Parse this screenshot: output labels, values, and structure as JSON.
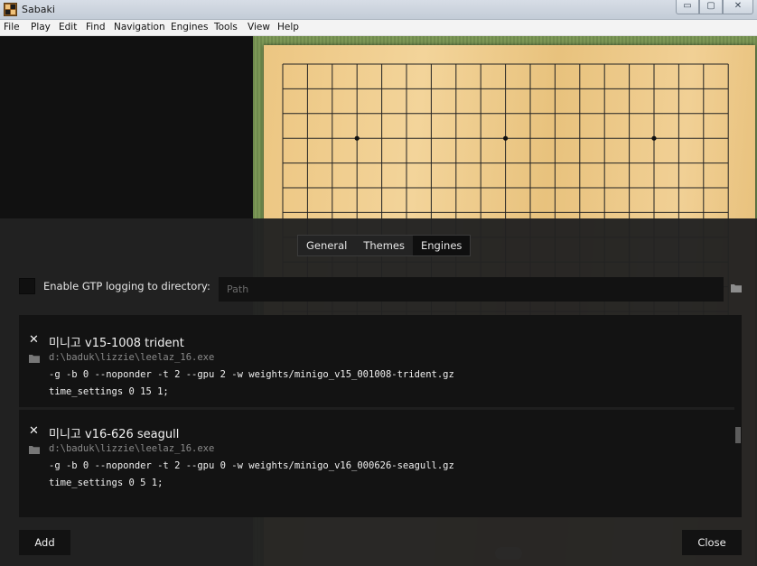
{
  "window": {
    "title": "Sabaki",
    "min_glyph": "▭",
    "max_glyph": "▢",
    "close_glyph": "✕"
  },
  "menu": [
    "File",
    "Play",
    "Edit",
    "Find",
    "Navigation",
    "Engines",
    "Tools",
    "View",
    "Help"
  ],
  "preferences": {
    "tabs": [
      "General",
      "Themes",
      "Engines"
    ],
    "active_tab": "Engines",
    "gtp_logging": {
      "label": "Enable GTP logging to directory:",
      "checked": false,
      "placeholder": "Path",
      "value": ""
    },
    "engines": [
      {
        "remove_glyph": "✕",
        "name": "미니고 v15-1008 trident",
        "path": "d:\\baduk\\lizzie\\leelaz_16.exe",
        "args": "-g -b 0 --noponder -t 2 --gpu 2 -w weights/minigo_v15_001008-trident.gz",
        "commands": "time_settings 0 15 1;"
      },
      {
        "remove_glyph": "✕",
        "name": "미니고 v16-626 seagull",
        "path": "d:\\baduk\\lizzie\\leelaz_16.exe",
        "args": "-g -b 0 --noponder -t 2 --gpu 0 -w weights/minigo_v16_000626-seagull.gz",
        "commands": "time_settings 0 5 1;"
      }
    ],
    "add_label": "Add",
    "close_label": "Close"
  },
  "icons": {
    "folder": "folder-icon",
    "remove": "close-icon"
  },
  "colors": {
    "drawer_bg": "#222222",
    "board_wood": "#f0cf92",
    "tatami": "#7d9857"
  }
}
